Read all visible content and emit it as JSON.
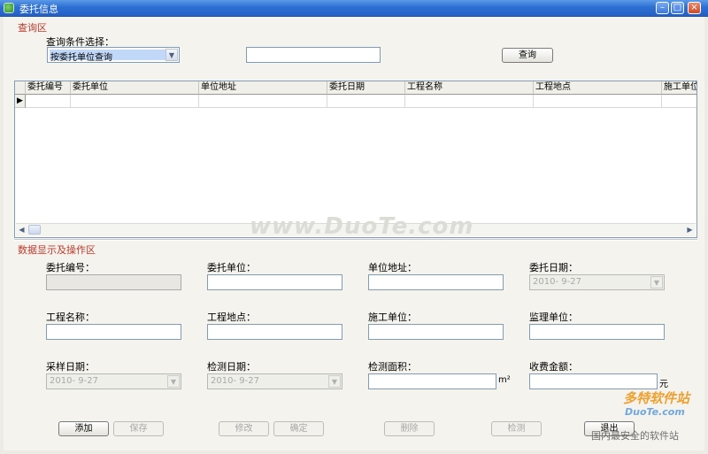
{
  "window": {
    "title": "委托信息",
    "min": "–",
    "max": "□",
    "close": "×"
  },
  "query": {
    "section_label": "查询区",
    "condition_label": "查询条件选择：",
    "condition_value": "按委托单位查询",
    "keyword_value": "",
    "search_button": "查询"
  },
  "grid": {
    "columns": [
      "委托编号",
      "委托单位",
      "单位地址",
      "委托日期",
      "工程名称",
      "工程地点",
      "施工单位"
    ],
    "row_marker": "▶",
    "scroll_left": "◀",
    "scroll_right": "▶"
  },
  "form": {
    "section_label": "数据显示及操作区",
    "fields": {
      "entrust_no": {
        "label": "委托编号：",
        "value": ""
      },
      "entrust_unit": {
        "label": "委托单位：",
        "value": ""
      },
      "unit_address": {
        "label": "单位地址：",
        "value": ""
      },
      "entrust_date": {
        "label": "委托日期：",
        "value": "2010- 9-27"
      },
      "project_name": {
        "label": "工程名称：",
        "value": ""
      },
      "project_site": {
        "label": "工程地点：",
        "value": ""
      },
      "builder": {
        "label": "施工单位：",
        "value": ""
      },
      "supervisor": {
        "label": "监理单位：",
        "value": ""
      },
      "sample_date": {
        "label": "采样日期：",
        "value": "2010- 9-27"
      },
      "test_date": {
        "label": "检测日期：",
        "value": "2010- 9-27"
      },
      "test_area": {
        "label": "检测面积：",
        "value": "",
        "unit": "m²"
      },
      "fee": {
        "label": "收费金额：",
        "value": "",
        "unit": "元"
      }
    }
  },
  "buttons": {
    "add": "添加",
    "save": "保存",
    "modify": "修改",
    "confirm": "确定",
    "delete": "删除",
    "detect": "检测",
    "exit": "退出"
  },
  "watermark": {
    "center": "www.DuoTe.com",
    "corner_brand": "多特软件站",
    "corner_site": "DuoTe.com",
    "corner_slogan": "国内最安全的软件站"
  }
}
